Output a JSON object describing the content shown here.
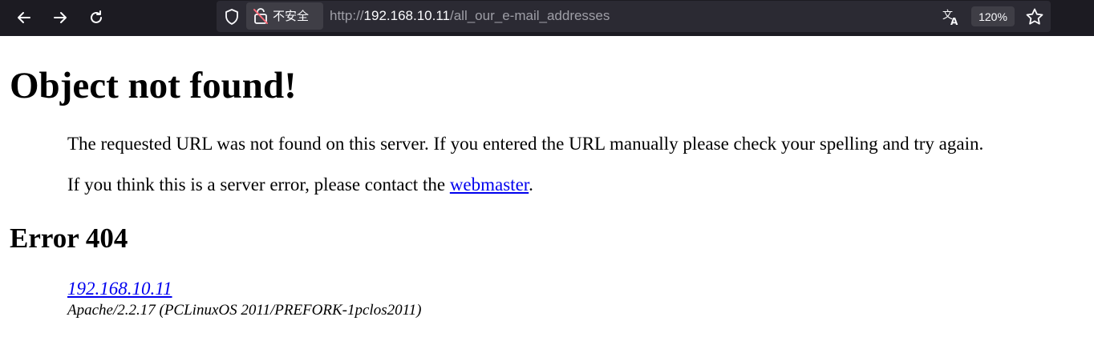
{
  "browser": {
    "security_label": "不安全",
    "url": {
      "protocol": "http://",
      "host": "192.168.10.11",
      "path": "/all_our_e-mail_addresses"
    },
    "zoom": "120%",
    "icons": [
      "back-icon",
      "forward-icon",
      "reload-icon",
      "shield-icon",
      "insecure-lock-icon",
      "translate-icon",
      "bookmark-star-icon"
    ],
    "colors": {
      "toolbar": "#1c1b22",
      "urlbar": "#2b2a33",
      "chip": "#3f3e46"
    }
  },
  "page": {
    "title": "Object not found!",
    "message": "The requested URL was not found on this server. If you entered the URL manually please check your spelling and try again.",
    "contact_prefix": "If you think this is a server error, please contact the ",
    "contact_link": "webmaster",
    "contact_suffix": ".",
    "error_heading": "Error 404",
    "host_link": "192.168.10.11",
    "server_signature": "Apache/2.2.17 (PCLinuxOS 2011/PREFORK-1pclos2011)",
    "link_color": "#0000ee"
  }
}
